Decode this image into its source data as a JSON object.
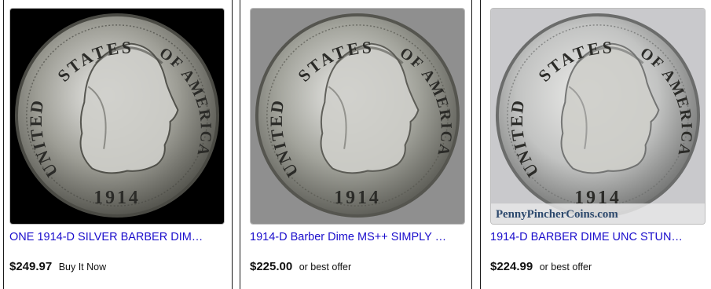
{
  "listings": [
    {
      "coin": {
        "legend_left": "UNITED",
        "legend_top": "STATES",
        "legend_right": "OF AMERICA",
        "date": "1914",
        "watermark": ""
      },
      "title": "ONE 1914-D SILVER BARBER DIM…",
      "price": "$249.97",
      "format": "Buy It Now",
      "bg": "#000000",
      "metal": "#9d9d95",
      "metal_dark": "#4a4a44"
    },
    {
      "coin": {
        "legend_left": "UNITED",
        "legend_top": "STATES",
        "legend_right": "OF AMERICA",
        "date": "1914",
        "watermark": ""
      },
      "title": "1914-D Barber Dime MS++ SIMPLY …",
      "price": "$225.00",
      "format": "or best offer",
      "bg": "#8f8f8f",
      "metal": "#a2a39b",
      "metal_dark": "#55554f"
    },
    {
      "coin": {
        "legend_left": "UNITED",
        "legend_top": "STATES",
        "legend_right": "OF AMERICA",
        "date": "1914",
        "watermark": "PennyPincherCoins.com"
      },
      "title": "1914-D BARBER DIME UNC STUN…",
      "price": "$224.99",
      "format": "or best offer",
      "bg": "#c9c9cc",
      "metal": "#c2c3c2",
      "metal_dark": "#6b6c6b"
    }
  ]
}
